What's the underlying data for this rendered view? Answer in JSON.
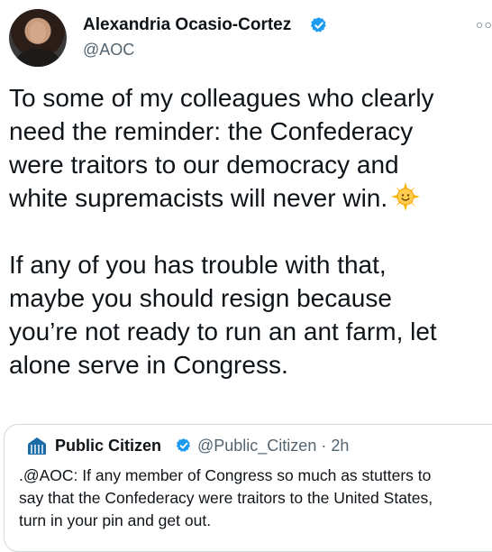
{
  "author": {
    "name": "Alexandria Ocasio-Cortez",
    "handle": "@AOC",
    "verified": true
  },
  "icons": {
    "avatar": "profile-photo",
    "verified": "verified-badge-icon",
    "more": "more-options-icon",
    "emoji": "sun-face-emoji"
  },
  "tweet": {
    "paragraph1": "To some of my colleagues who clearly\nneed the reminder: the Confederacy\nwere traitors to our democracy and\nwhite supremacists will never win.",
    "paragraph2": "If any of you has trouble with that,\nmaybe you should resign because\nyou’re not ready to run an ant farm, let\nalone serve in Congress."
  },
  "quoted_tweet": {
    "name": "Public Citizen",
    "handle": "@Public_Citizen",
    "separator": "·",
    "time": "2h",
    "text": ".@AOC: If any member of Congress so much as stutters to\nsay that the Confederacy were traitors to the United States,\nturn in your pin and get out."
  },
  "colors": {
    "verified_blue": "#1d9bf0",
    "secondary_text": "#536471",
    "border": "#cfd9de"
  }
}
